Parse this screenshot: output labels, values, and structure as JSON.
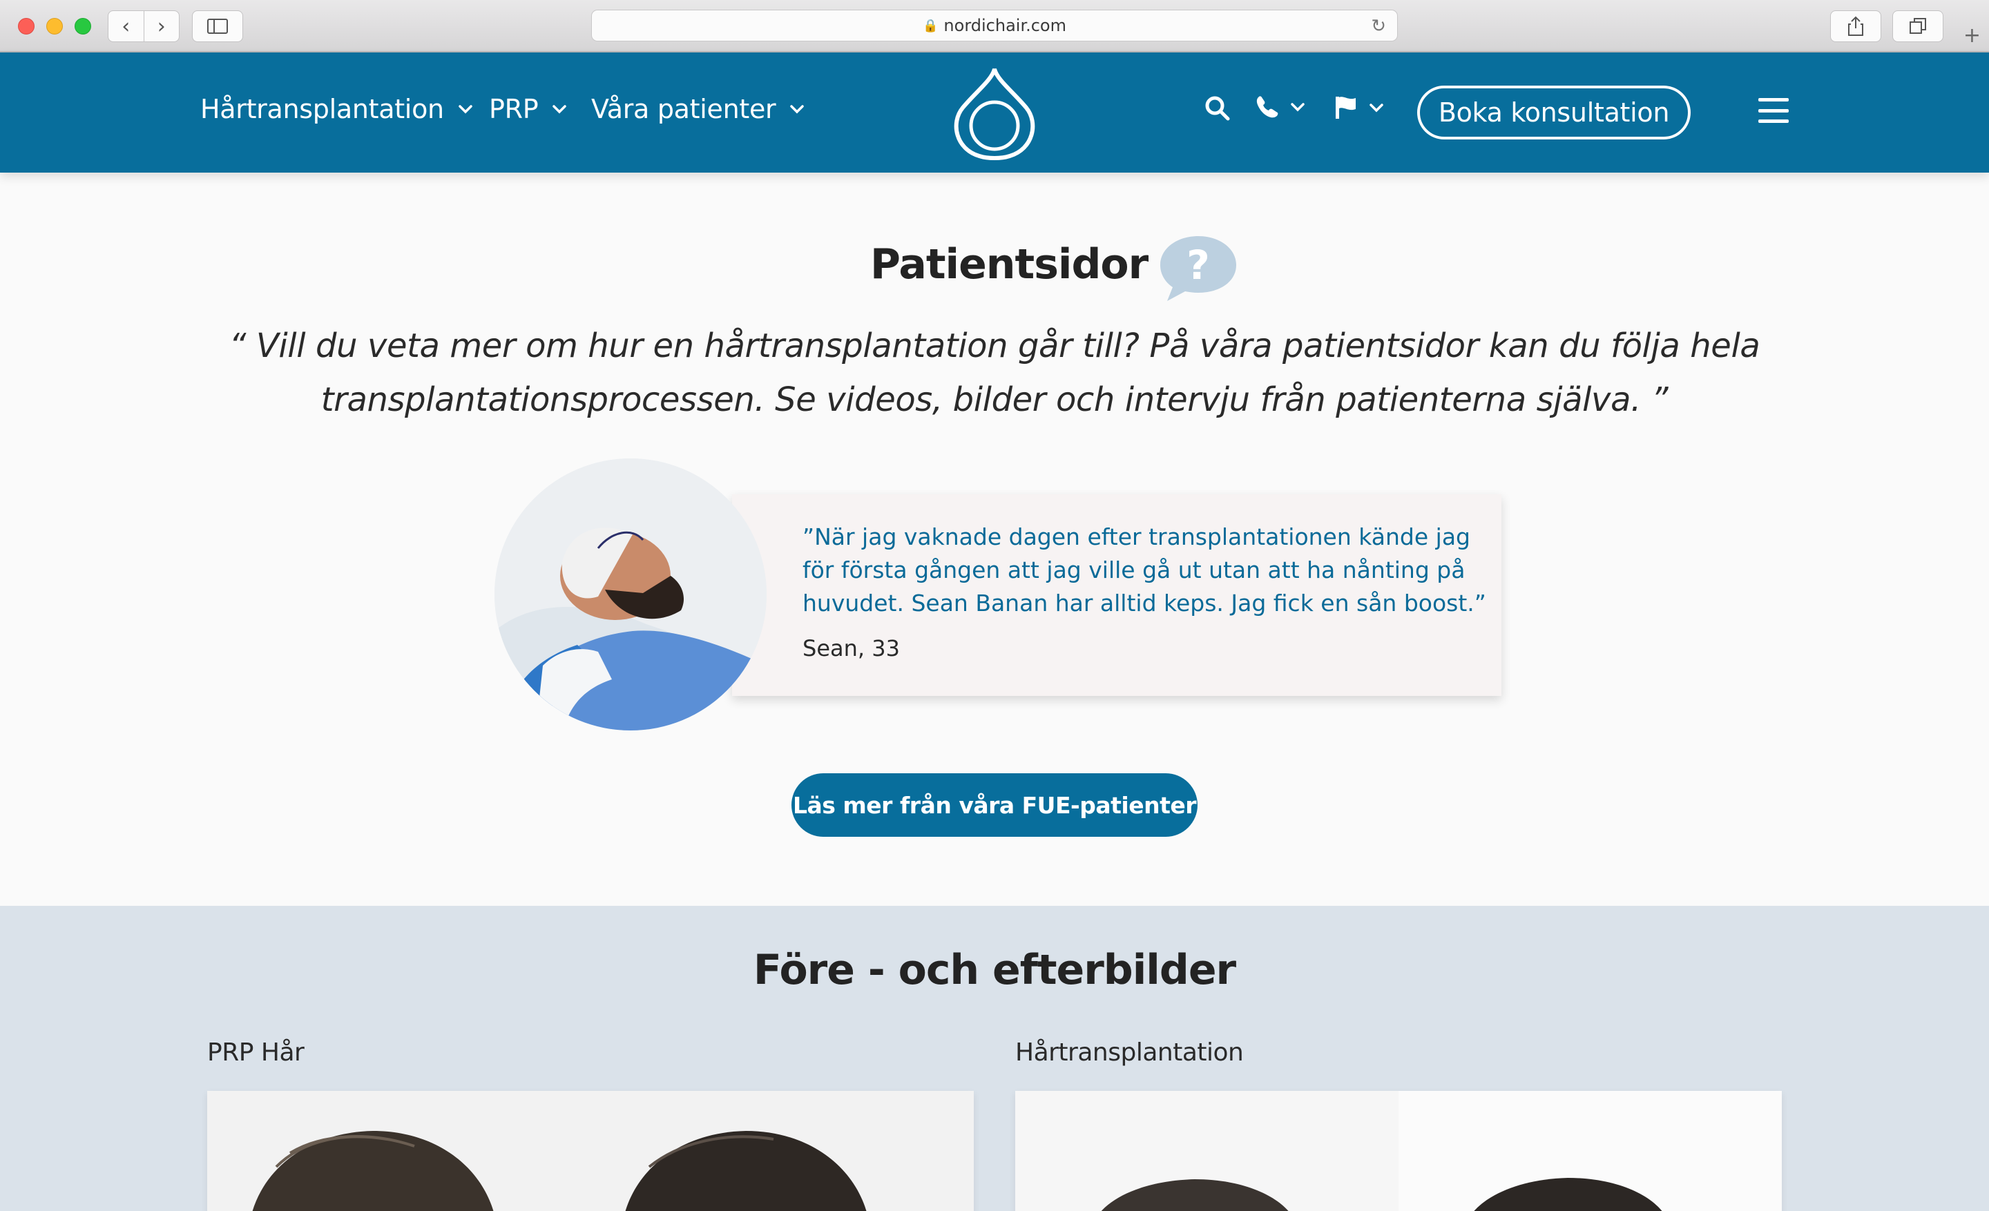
{
  "browser": {
    "url": "nordichair.com",
    "back_glyph": "‹",
    "forward_glyph": "›"
  },
  "nav": {
    "items": [
      {
        "label": "Hårtransplantation"
      },
      {
        "label": "PRP"
      },
      {
        "label": "Våra patienter"
      }
    ],
    "book_label": "Boka konsultation"
  },
  "patients": {
    "title": "Patientsidor",
    "quote": "“ Vill du veta mer om hur en hårtransplantation går till? På våra patientsidor kan du följa hela transplantationsprocessen. Se videos, bilder och intervju från patienterna själva. ”",
    "testimonial": {
      "text": "”När jag vaknade dagen efter transplantationen kände jag för första gången att jag ville gå ut utan att ha nånting på huvudet. Sean Banan har alltid keps. Jag fick en sån boost.”",
      "name": "Sean, 33"
    },
    "cta_label": "Läs mer från våra FUE-patienter"
  },
  "before_after": {
    "title": "Före - och efterbilder",
    "left_label": "PRP Hår",
    "right_label": "Hårtransplantation"
  },
  "colors": {
    "brand": "#086e9c",
    "section_bg": "#dae2ea"
  }
}
